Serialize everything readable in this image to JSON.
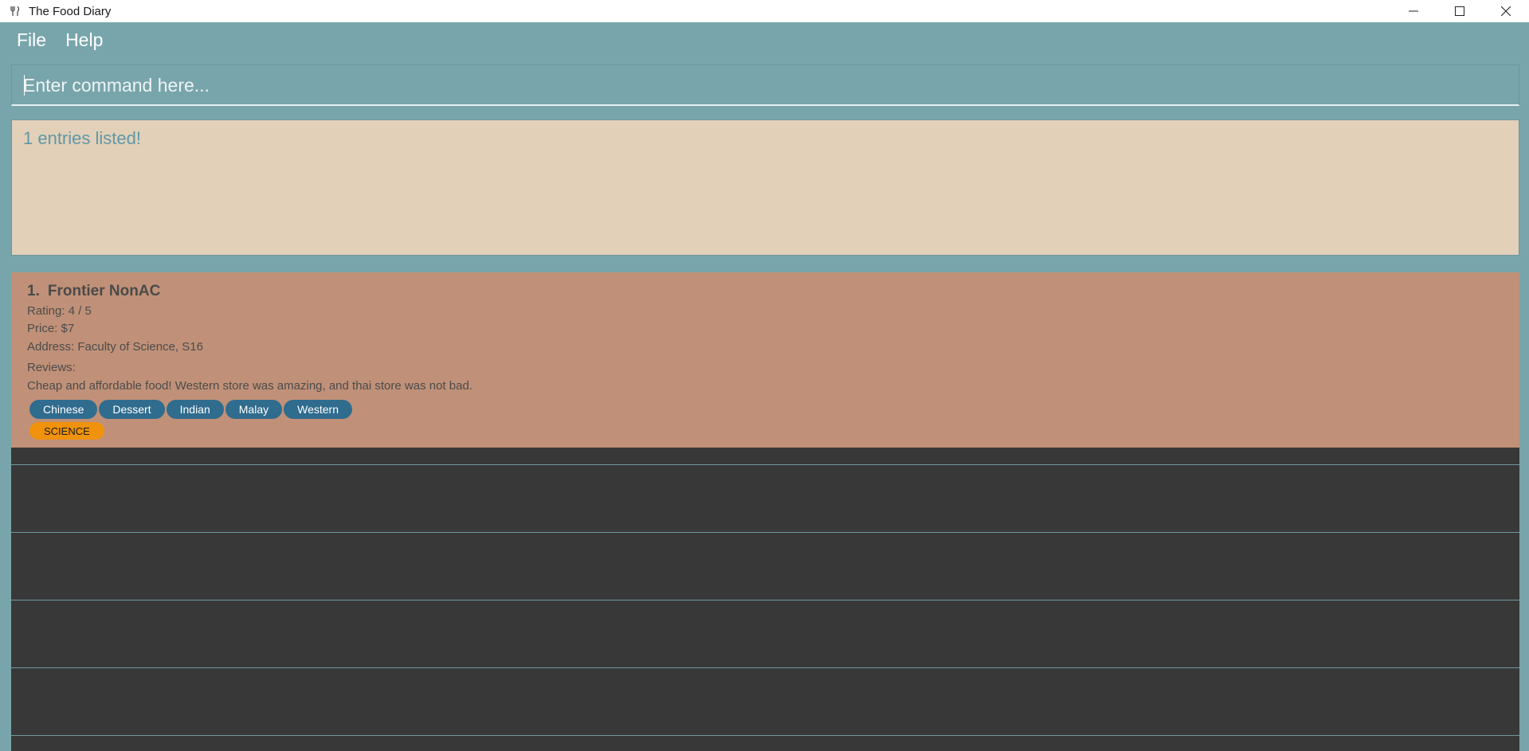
{
  "window": {
    "title": "The Food Diary"
  },
  "menu": {
    "items": [
      "File",
      "Help"
    ]
  },
  "command": {
    "placeholder": "Enter command here...",
    "value": ""
  },
  "result": {
    "message": "1 entries listed!"
  },
  "entries": [
    {
      "index": "1.",
      "name": "Frontier NonAC",
      "rating": "Rating: 4 / 5",
      "price": "Price: $7",
      "address": "Address: Faculty of Science, S16",
      "reviews_label": "Reviews:",
      "review": "Cheap and affordable food! Western store was amazing, and thai store was not bad.",
      "categories": [
        "Chinese",
        "Dessert",
        "Indian",
        "Malay",
        "Western"
      ],
      "school": "SCIENCE"
    }
  ],
  "colors": {
    "accent": "#78a5ab",
    "result_bg": "#e2d0b8",
    "card_bg": "#c09178",
    "tag_bg": "#2f6c8e",
    "school_tag_bg": "#f0920c",
    "list_bg": "#383838"
  }
}
